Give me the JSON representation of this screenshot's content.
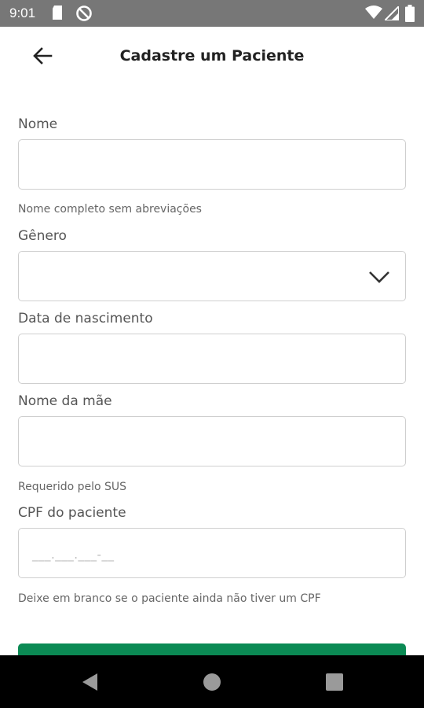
{
  "status_bar": {
    "time": "9:01",
    "icons": [
      "sd-card-icon",
      "do-not-disturb-icon",
      "wifi-icon",
      "signal-icon",
      "battery-icon"
    ]
  },
  "header": {
    "title": "Cadastre um Paciente",
    "back_icon": "arrow-back-icon"
  },
  "form": {
    "nome": {
      "label": "Nome",
      "value": "",
      "helper": "Nome completo sem abreviações"
    },
    "genero": {
      "label": "Gênero",
      "value": "",
      "icon": "chevron-down-icon"
    },
    "data_nascimento": {
      "label": "Data de nascimento",
      "value": ""
    },
    "nome_mae": {
      "label": "Nome da mãe",
      "value": "",
      "helper": "Requerido pelo SUS"
    },
    "cpf": {
      "label": "CPF do paciente",
      "value": "",
      "placeholder": "___.___.___-__",
      "helper": "Deixe em branco se o paciente ainda não tiver um CPF"
    }
  },
  "colors": {
    "status_bar": "#777777",
    "accent_green": "#0b8a54",
    "nav_bar": "#000000"
  },
  "nav_bar": {
    "icons": [
      "back-triangle-icon",
      "home-circle-icon",
      "recents-square-icon"
    ]
  }
}
